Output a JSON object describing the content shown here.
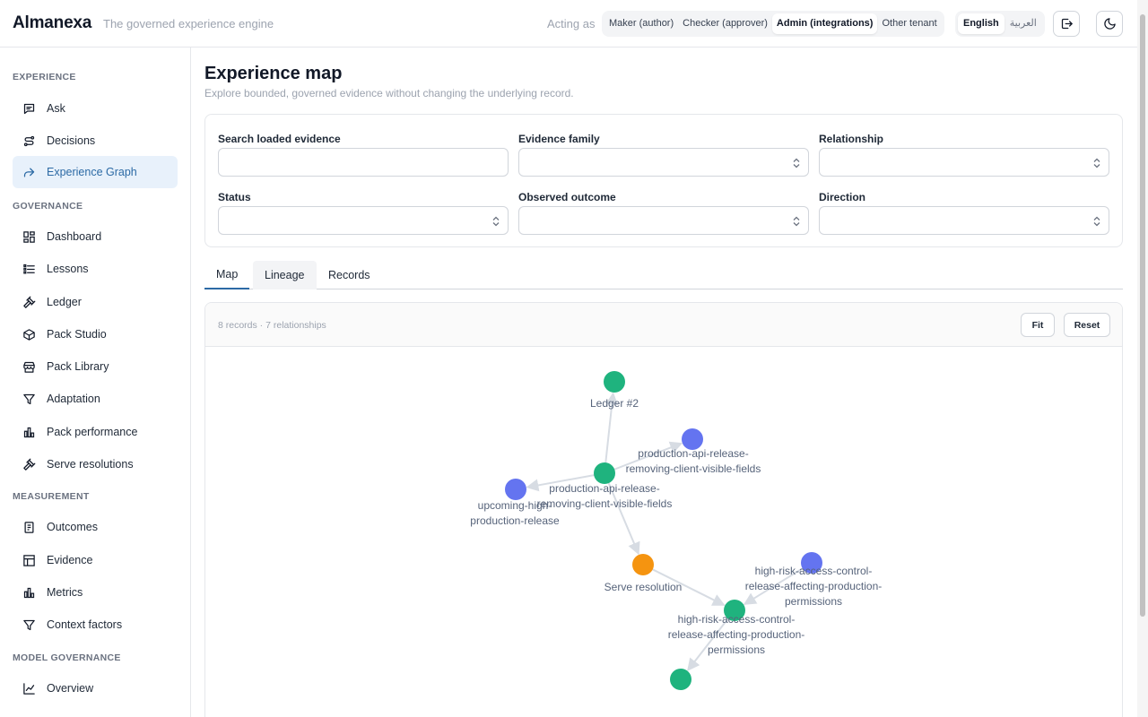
{
  "header": {
    "brand": "Almanexa",
    "tagline": "The governed experience engine",
    "acting_label": "Acting as",
    "roles": [
      {
        "label": "Maker (author)",
        "active": false
      },
      {
        "label": "Checker (approver)",
        "active": false
      },
      {
        "label": "Admin (integrations)",
        "active": true
      },
      {
        "label": "Other tenant",
        "active": false
      }
    ],
    "languages": [
      {
        "label": "English",
        "active": true
      },
      {
        "label": "العربية",
        "active": false
      }
    ],
    "icons": {
      "logout": "logout-icon",
      "theme": "moon-icon"
    }
  },
  "sidebar": {
    "sections": [
      {
        "title": "EXPERIENCE",
        "items": [
          {
            "label": "Ask",
            "icon": "chat-icon",
            "active": false
          },
          {
            "label": "Decisions",
            "icon": "route-icon",
            "active": false
          },
          {
            "label": "Experience Graph",
            "icon": "share-icon",
            "active": true
          }
        ]
      },
      {
        "title": "GOVERNANCE",
        "items": [
          {
            "label": "Dashboard",
            "icon": "dashboard-icon",
            "active": false
          },
          {
            "label": "Lessons",
            "icon": "list-icon",
            "active": false
          },
          {
            "label": "Ledger",
            "icon": "gavel-icon",
            "active": false
          },
          {
            "label": "Pack Studio",
            "icon": "box-icon",
            "active": false
          },
          {
            "label": "Pack Library",
            "icon": "store-icon",
            "active": false
          },
          {
            "label": "Adaptation",
            "icon": "funnel-icon",
            "active": false
          },
          {
            "label": "Pack performance",
            "icon": "bar-chart-icon",
            "active": false
          },
          {
            "label": "Serve resolutions",
            "icon": "gavel-icon",
            "active": false
          }
        ]
      },
      {
        "title": "MEASUREMENT",
        "items": [
          {
            "label": "Outcomes",
            "icon": "clipboard-icon",
            "active": false
          },
          {
            "label": "Evidence",
            "icon": "layout-icon",
            "active": false
          },
          {
            "label": "Metrics",
            "icon": "bar-chart-icon",
            "active": false
          },
          {
            "label": "Context factors",
            "icon": "funnel-icon",
            "active": false
          }
        ]
      },
      {
        "title": "MODEL GOVERNANCE",
        "items": [
          {
            "label": "Overview",
            "icon": "line-chart-icon",
            "active": false
          }
        ]
      }
    ]
  },
  "main": {
    "title": "Experience map",
    "subtitle": "Explore bounded, governed evidence without changing the underlying record.",
    "filters": {
      "search_label": "Search loaded evidence",
      "search_value": "",
      "family_label": "Evidence family",
      "relationship_label": "Relationship",
      "status_label": "Status",
      "outcome_label": "Observed outcome",
      "direction_label": "Direction"
    },
    "tabs": [
      {
        "label": "Map",
        "active": true
      },
      {
        "label": "Lineage",
        "active": false
      },
      {
        "label": "Records",
        "active": false
      }
    ],
    "graph": {
      "summary": "8 records · 7 relationships",
      "fit_label": "Fit",
      "reset_label": "Reset",
      "colors": {
        "green": "#1fb37e",
        "blue": "#6474f0",
        "orange": "#f59410",
        "edge": "#d7dce3"
      },
      "nodes": [
        {
          "id": "n1",
          "label_lines": [
            "Ledger #2"
          ],
          "color": "green"
        },
        {
          "id": "n2",
          "label_lines": [
            "production-api-release-",
            "removing-client-visible-fields"
          ],
          "color": "blue"
        },
        {
          "id": "n3",
          "label_lines": [
            "production-api-release-",
            "removing-client-visible-fields"
          ],
          "color": "green"
        },
        {
          "id": "n4",
          "label_lines": [
            "upcoming-high-",
            "production-release"
          ],
          "color": "blue"
        },
        {
          "id": "n5",
          "label_lines": [
            "Serve resolution"
          ],
          "color": "orange"
        },
        {
          "id": "n6",
          "label_lines": [
            "high-risk-access-control-",
            "release-affecting-production-",
            "permissions"
          ],
          "color": "blue"
        },
        {
          "id": "n7",
          "label_lines": [
            "high-risk-access-control-",
            "release-affecting-production-",
            "permissions"
          ],
          "color": "green"
        },
        {
          "id": "n8",
          "label_lines": [],
          "color": "green"
        }
      ]
    }
  }
}
